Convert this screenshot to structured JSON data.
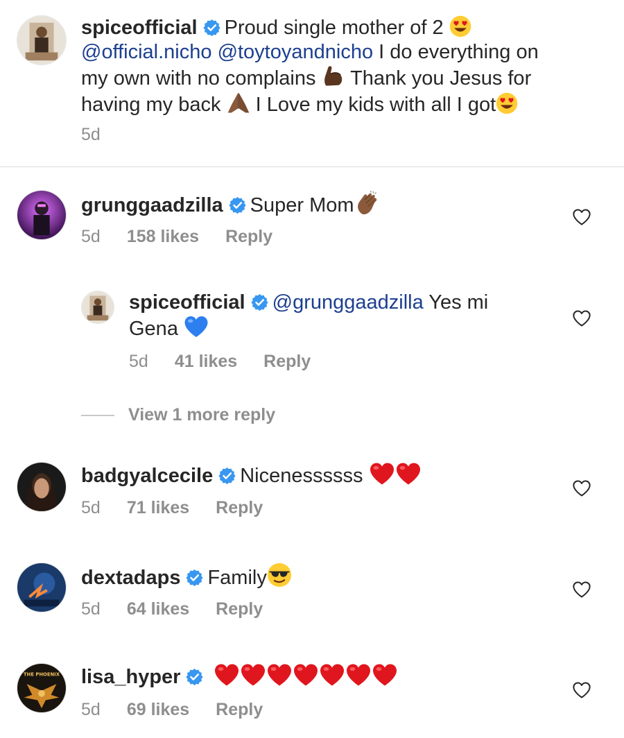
{
  "caption": {
    "username": "spiceofficial",
    "line1": "Proud single mother of 2",
    "mention1": "@official.nicho",
    "mention2": "@toytoyandnicho",
    "text2": "I do everything on",
    "line3a": "my own with no complains",
    "line3b": "Thank you Jesus for",
    "line4a": "having my back",
    "line4b": "I Love  my kids with all I got",
    "time": "5d"
  },
  "comments": [
    {
      "username": "grunggaadzilla",
      "text": "Super Mom",
      "time": "5d",
      "likes": "158 likes",
      "reply": "Reply"
    },
    {
      "username": "spiceofficial",
      "mention": "@grunggaadzilla",
      "text1": "Yes mi",
      "text2": "Gena",
      "time": "5d",
      "likes": "41 likes",
      "reply": "Reply"
    },
    {
      "username": "badgyalcecile",
      "text": "Nicenessssss",
      "time": "5d",
      "likes": "71 likes",
      "reply": "Reply"
    },
    {
      "username": "dextadaps",
      "text": "Family",
      "time": "5d",
      "likes": "64 likes",
      "reply": "Reply"
    },
    {
      "username": "lisa_hyper",
      "time": "5d",
      "likes": "69 likes",
      "reply": "Reply"
    }
  ],
  "view_more": "View 1 more reply",
  "lisa_avatar_text": "THE PHOENIX",
  "icons": {
    "verified": "verified-badge-icon",
    "heart": "heart-outline-icon"
  },
  "colors": {
    "text": "#262626",
    "secondary": "#8e8e8e",
    "mention": "#1c3f8f",
    "verified": "#3897f0",
    "heart_red": "#e0161e"
  }
}
